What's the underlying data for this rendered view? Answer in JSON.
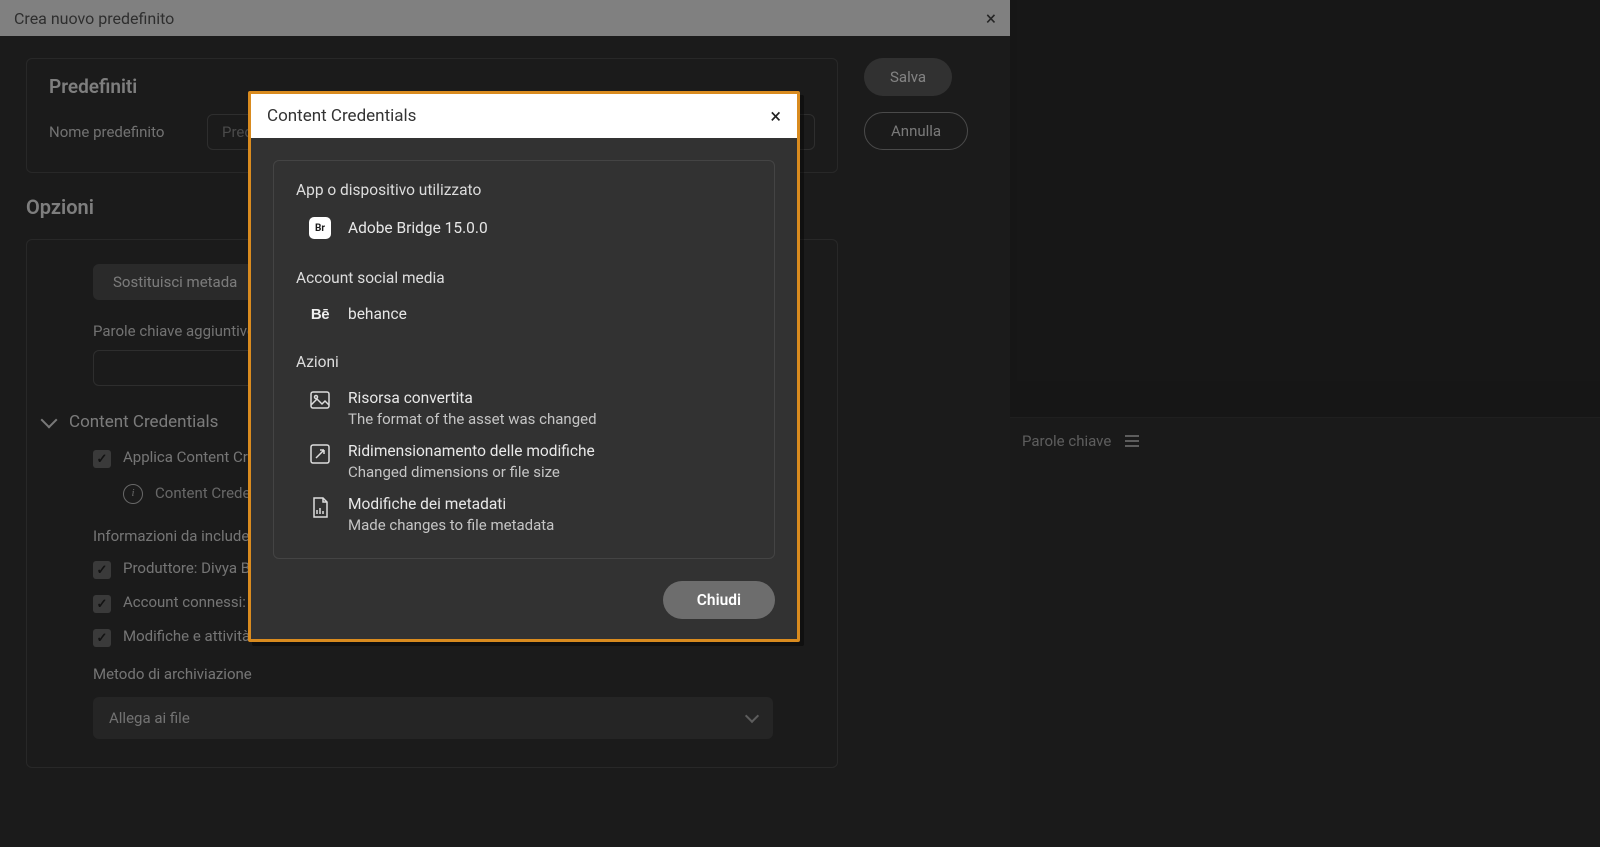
{
  "background_dialog": {
    "title": "Crea nuovo predefinito",
    "close_icon": "×",
    "save_btn": "Salva",
    "cancel_btn": "Annulla",
    "presets_fieldset_title": "Predefiniti",
    "preset_name_label": "Nome predefinito",
    "preset_name_placeholder": "Predefin",
    "options_title": "Opzioni",
    "replace_meta_btn": "Sostituisci metada",
    "extra_keywords_label": "Parole chiave aggiuntive",
    "cc_section_title": "Content Credentials",
    "apply_cc_label": "Applica Content Cr",
    "cc_info_text": "Content Crede adding below assets will ma take longer wi",
    "include_label": "Informazioni da include",
    "producer_label": "Produttore: Divya B",
    "accounts_label": "Account connessi: b",
    "changes_label": "Modifiche e attività",
    "storage_label": "Metodo di archiviazione",
    "storage_value": "Allega ai file"
  },
  "right_panel": {
    "title": "Parole chiave"
  },
  "modal": {
    "title": "Content Credentials",
    "close_icon": "×",
    "app_section": "App o dispositivo utilizzato",
    "app_name": "Adobe Bridge 15.0.0",
    "br_badge": "Br",
    "social_section": "Account social media",
    "behance_label": "behance",
    "behance_icon": "Bē",
    "actions_section": "Azioni",
    "actions": [
      {
        "title": "Risorsa convertita",
        "desc": "The format of the asset was changed"
      },
      {
        "title": "Ridimensionamento delle modifiche",
        "desc": "Changed dimensions or file size"
      },
      {
        "title": "Modifiche dei metadati",
        "desc": "Made changes to file metadata"
      }
    ],
    "close_btn": "Chiudi"
  }
}
